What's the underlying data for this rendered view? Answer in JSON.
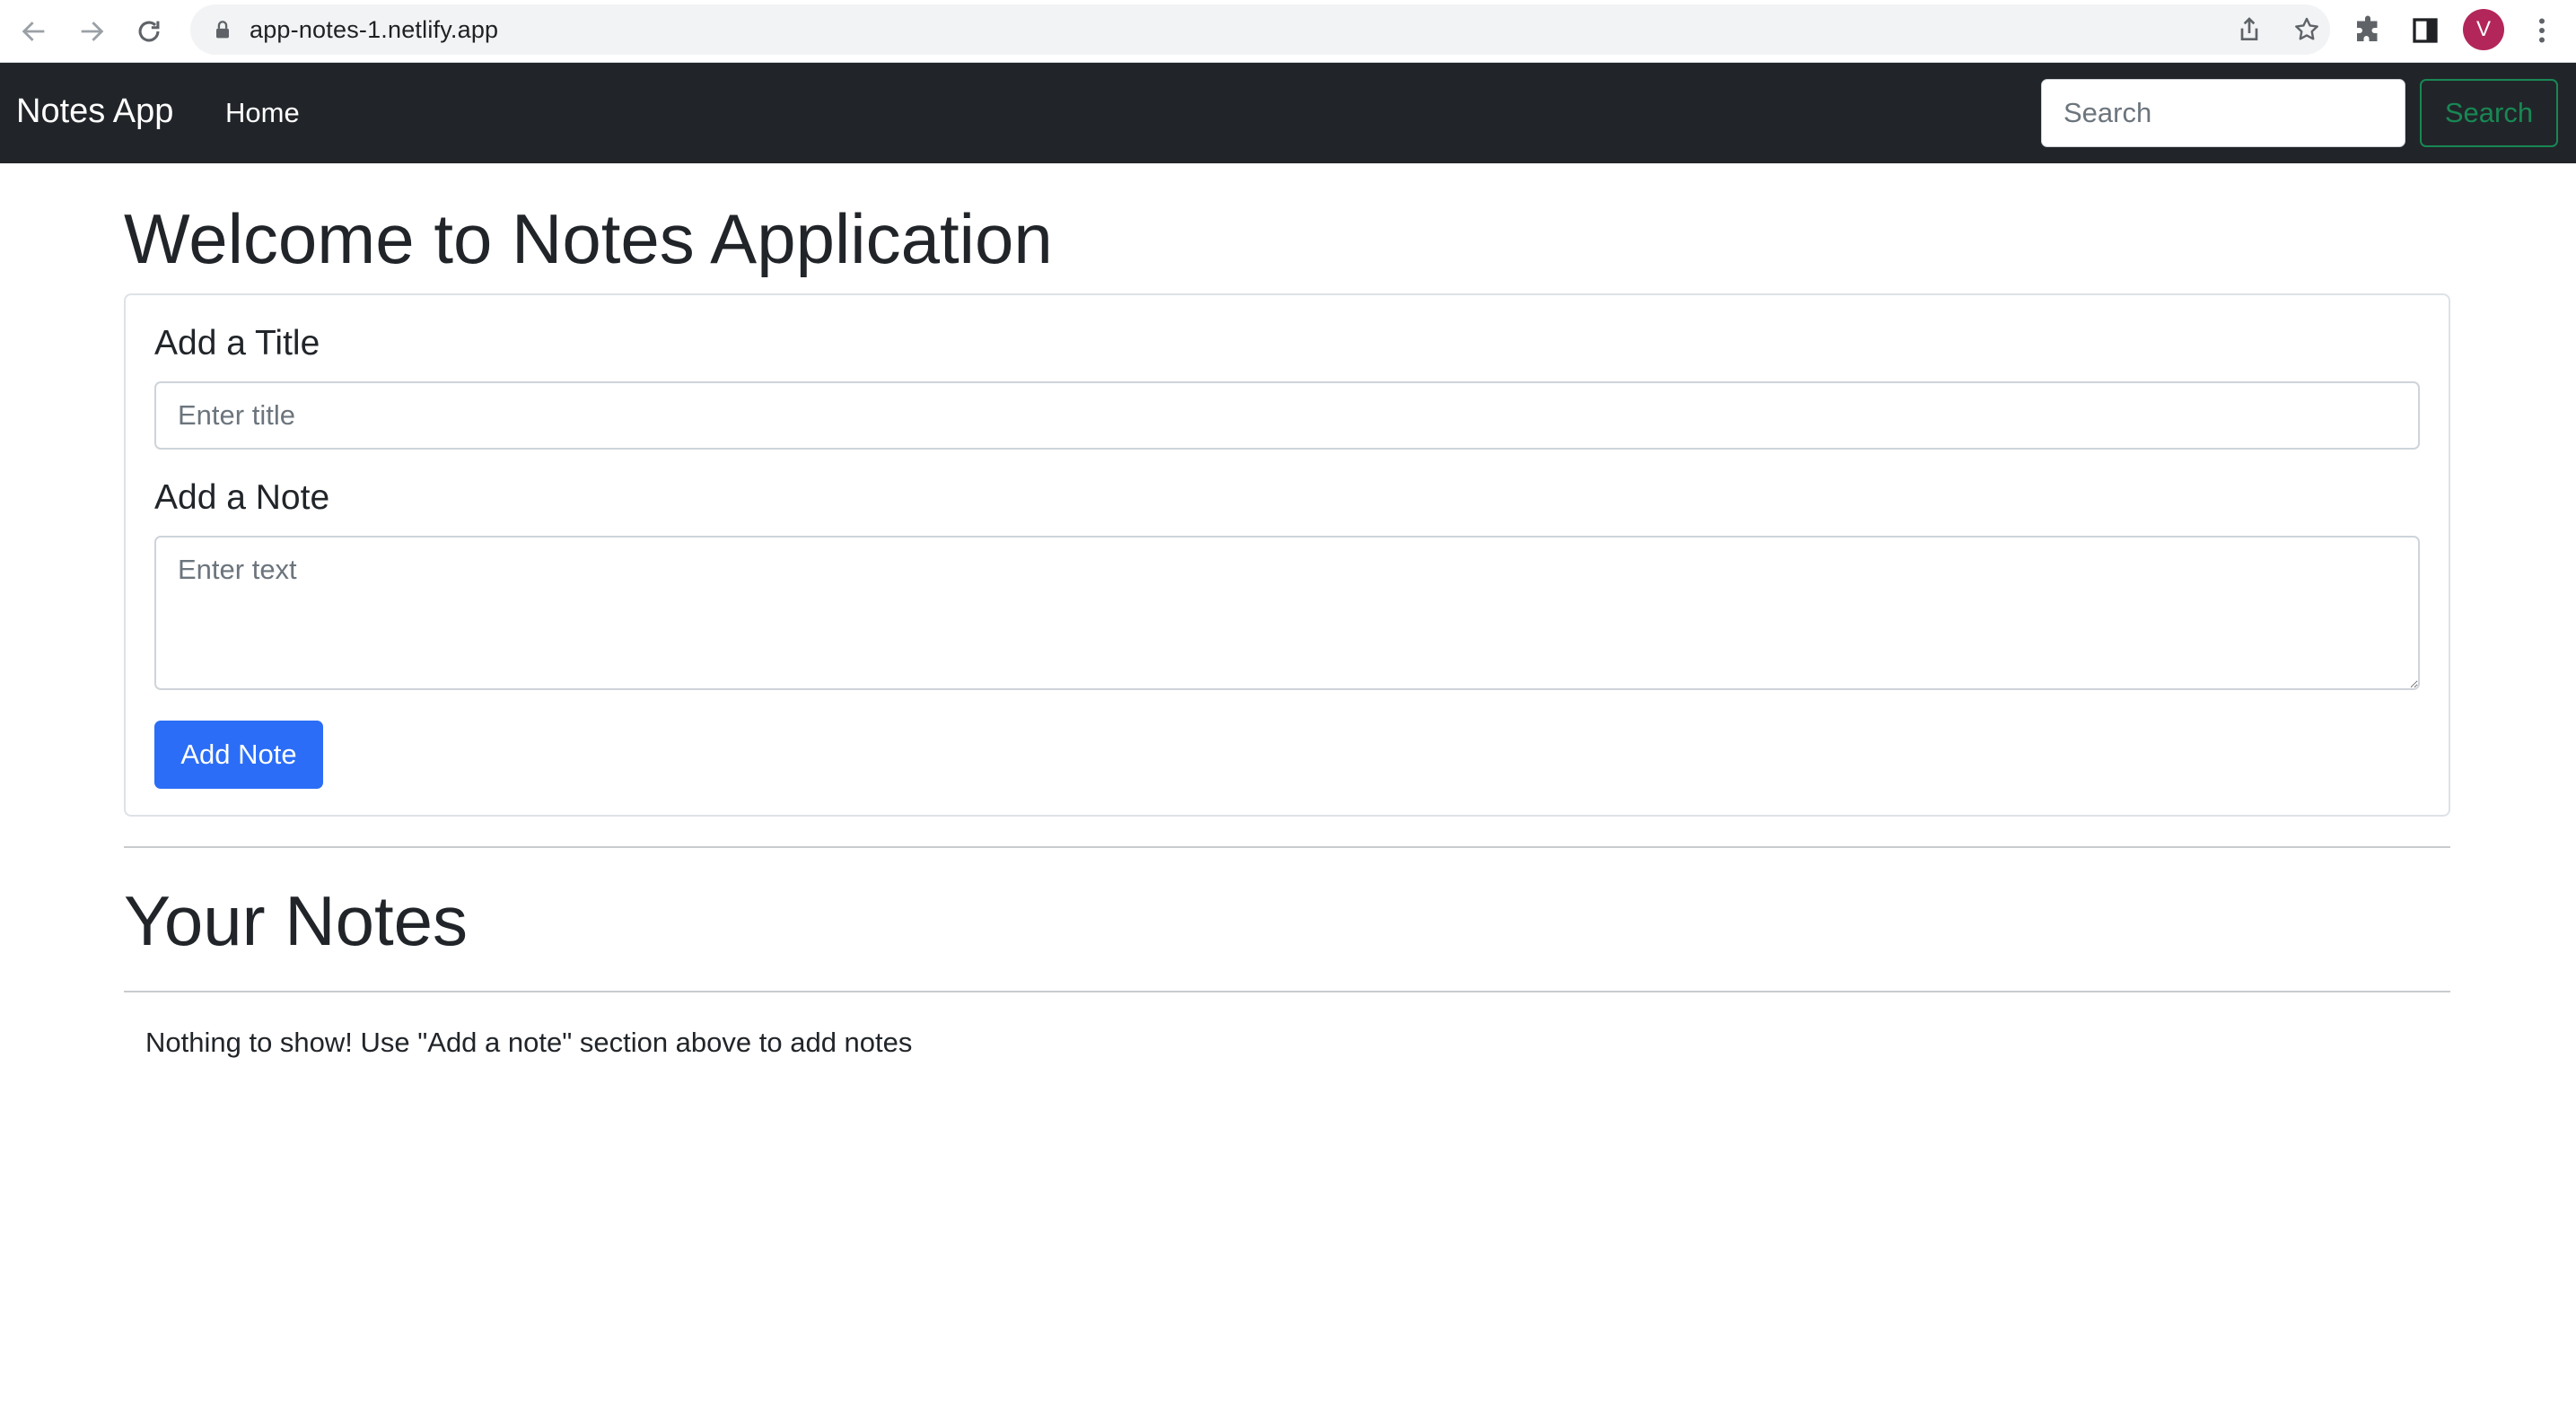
{
  "browser": {
    "url": "app-notes-1.netlify.app",
    "avatar_letter": "V",
    "avatar_color": "#b3265a"
  },
  "navbar": {
    "brand": "Notes App",
    "home_link": "Home",
    "search_placeholder": "Search",
    "search_button": "Search",
    "background": "#212529",
    "search_button_color": "#198754"
  },
  "main": {
    "title": "Welcome to Notes Application",
    "form": {
      "title_label": "Add a Title",
      "title_placeholder": "Enter title",
      "title_value": "",
      "note_label": "Add a Note",
      "note_placeholder": "Enter text",
      "note_value": "",
      "add_button": "Add Note",
      "add_button_color": "#2b6df6"
    },
    "notes_heading": "Your Notes",
    "empty_message": "Nothing to show! Use \"Add a note\" section above to add notes"
  }
}
